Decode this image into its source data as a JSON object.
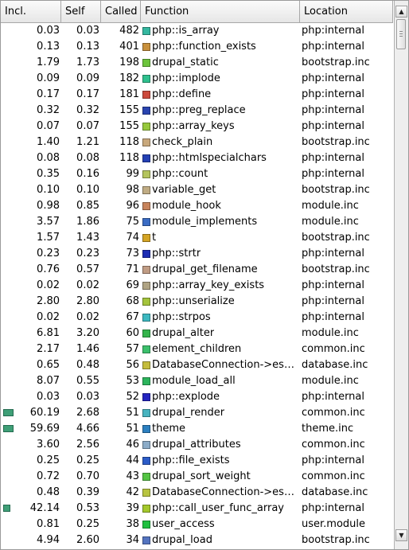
{
  "columns": {
    "incl": "Incl.",
    "self": "Self",
    "called": "Called",
    "function": "Function",
    "location": "Location"
  },
  "rows": [
    {
      "incl": "0.03",
      "self": "0.03",
      "called": "482",
      "function": "php::is_array",
      "location": "php:internal",
      "color": "#35b8a0",
      "incl_fraction": null
    },
    {
      "incl": "0.13",
      "self": "0.13",
      "called": "401",
      "function": "php::function_exists",
      "location": "php:internal",
      "color": "#c8903c",
      "incl_fraction": null
    },
    {
      "incl": "1.79",
      "self": "1.73",
      "called": "198",
      "function": "drupal_static",
      "location": "bootstrap.inc",
      "color": "#6cc43c",
      "incl_fraction": null
    },
    {
      "incl": "0.09",
      "self": "0.09",
      "called": "182",
      "function": "php::implode",
      "location": "php:internal",
      "color": "#2ec08e",
      "incl_fraction": null
    },
    {
      "incl": "0.17",
      "self": "0.17",
      "called": "181",
      "function": "php::define",
      "location": "php:internal",
      "color": "#cc4a3c",
      "incl_fraction": null
    },
    {
      "incl": "0.32",
      "self": "0.32",
      "called": "155",
      "function": "php::preg_replace",
      "location": "php:internal",
      "color": "#2a44b0",
      "incl_fraction": null
    },
    {
      "incl": "0.07",
      "self": "0.07",
      "called": "155",
      "function": "php::array_keys",
      "location": "php:internal",
      "color": "#96c83c",
      "incl_fraction": null
    },
    {
      "incl": "1.40",
      "self": "1.21",
      "called": "118",
      "function": "check_plain",
      "location": "bootstrap.inc",
      "color": "#c8a87c",
      "incl_fraction": null
    },
    {
      "incl": "0.08",
      "self": "0.08",
      "called": "118",
      "function": "php::htmlspecialchars",
      "location": "php:internal",
      "color": "#2440b4",
      "incl_fraction": null
    },
    {
      "incl": "0.35",
      "self": "0.16",
      "called": "99",
      "function": "php::count",
      "location": "php:internal",
      "color": "#b4c45c",
      "incl_fraction": null
    },
    {
      "incl": "0.10",
      "self": "0.10",
      "called": "98",
      "function": "variable_get",
      "location": "bootstrap.inc",
      "color": "#c0ac84",
      "incl_fraction": null
    },
    {
      "incl": "0.98",
      "self": "0.85",
      "called": "96",
      "function": "module_hook",
      "location": "module.inc",
      "color": "#c8845c",
      "incl_fraction": null
    },
    {
      "incl": "3.57",
      "self": "1.86",
      "called": "75",
      "function": "module_implements",
      "location": "module.inc",
      "color": "#3a6cc4",
      "incl_fraction": null
    },
    {
      "incl": "1.57",
      "self": "1.43",
      "called": "74",
      "function": "t",
      "location": "bootstrap.inc",
      "color": "#d4a424",
      "incl_fraction": null
    },
    {
      "incl": "0.23",
      "self": "0.23",
      "called": "73",
      "function": "php::strtr",
      "location": "php:internal",
      "color": "#1c2cb4",
      "incl_fraction": null
    },
    {
      "incl": "0.76",
      "self": "0.57",
      "called": "71",
      "function": "drupal_get_filename",
      "location": "bootstrap.inc",
      "color": "#c09c84",
      "incl_fraction": null
    },
    {
      "incl": "0.02",
      "self": "0.02",
      "called": "69",
      "function": "php::array_key_exists",
      "location": "php:internal",
      "color": "#b0a484",
      "incl_fraction": null
    },
    {
      "incl": "2.80",
      "self": "2.80",
      "called": "68",
      "function": "php::unserialize",
      "location": "php:internal",
      "color": "#a4c43c",
      "incl_fraction": null
    },
    {
      "incl": "0.02",
      "self": "0.02",
      "called": "67",
      "function": "php::strpos",
      "location": "php:internal",
      "color": "#3cb8c0",
      "incl_fraction": null
    },
    {
      "incl": "6.81",
      "self": "3.20",
      "called": "60",
      "function": "drupal_alter",
      "location": "module.inc",
      "color": "#34b44c",
      "incl_fraction": null
    },
    {
      "incl": "2.17",
      "self": "1.46",
      "called": "57",
      "function": "element_children",
      "location": "common.inc",
      "color": "#3cc06c",
      "incl_fraction": null
    },
    {
      "incl": "0.65",
      "self": "0.48",
      "called": "56",
      "function": "DatabaseConnection->esc…",
      "location": "database.inc",
      "color": "#c4bc3c",
      "incl_fraction": null
    },
    {
      "incl": "8.07",
      "self": "0.55",
      "called": "53",
      "function": "module_load_all",
      "location": "module.inc",
      "color": "#2cb45c",
      "incl_fraction": null
    },
    {
      "incl": "0.03",
      "self": "0.03",
      "called": "52",
      "function": "php::explode",
      "location": "php:internal",
      "color": "#2424c0",
      "incl_fraction": null
    },
    {
      "incl": "60.19",
      "self": "2.68",
      "called": "51",
      "function": "drupal_render",
      "location": "common.inc",
      "color": "#48b4c0",
      "incl_fraction": 0.6019
    },
    {
      "incl": "59.69",
      "self": "4.66",
      "called": "51",
      "function": "theme",
      "location": "theme.inc",
      "color": "#2c80c0",
      "incl_fraction": 0.5969
    },
    {
      "incl": "3.60",
      "self": "2.56",
      "called": "46",
      "function": "drupal_attributes",
      "location": "common.inc",
      "color": "#8cacc8",
      "incl_fraction": null
    },
    {
      "incl": "0.25",
      "self": "0.25",
      "called": "44",
      "function": "php::file_exists",
      "location": "php:internal",
      "color": "#2c5cc8",
      "incl_fraction": null
    },
    {
      "incl": "0.72",
      "self": "0.70",
      "called": "43",
      "function": "drupal_sort_weight",
      "location": "common.inc",
      "color": "#54c444",
      "incl_fraction": null
    },
    {
      "incl": "0.48",
      "self": "0.39",
      "called": "42",
      "function": "DatabaseConnection->esc…",
      "location": "database.inc",
      "color": "#b8c440",
      "incl_fraction": null
    },
    {
      "incl": "42.14",
      "self": "0.53",
      "called": "39",
      "function": "php::call_user_func_array",
      "location": "php:internal",
      "color": "#a4c82c",
      "incl_fraction": 0.4214
    },
    {
      "incl": "0.81",
      "self": "0.25",
      "called": "38",
      "function": "user_access",
      "location": "user.module",
      "color": "#20c040",
      "incl_fraction": null
    },
    {
      "incl": "4.94",
      "self": "2.60",
      "called": "34",
      "function": "drupal_load",
      "location": "bootstrap.inc",
      "color": "#5474c0",
      "incl_fraction": null
    }
  ],
  "colors": {
    "cost_bar": "#3f9f77",
    "header_border": "#a8a8a8"
  },
  "icons": {
    "scroll_up": "arrow-up-icon",
    "scroll_down": "arrow-down-icon"
  }
}
